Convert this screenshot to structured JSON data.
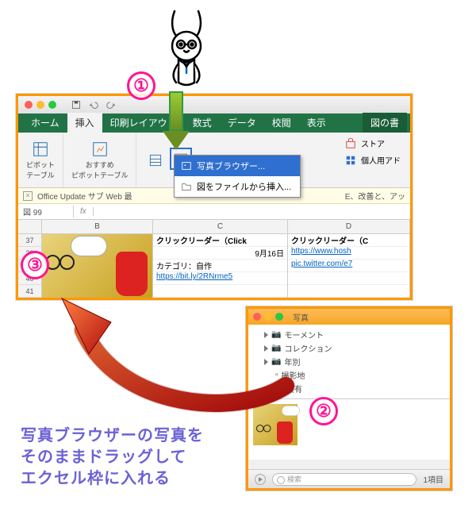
{
  "steps": {
    "one": "①",
    "two": "②",
    "three": "③"
  },
  "excel": {
    "tabs": {
      "home": "ホーム",
      "insert": "挿入",
      "page_layout": "印刷レイアウト",
      "formulas": "数式",
      "data": "データ",
      "review": "校閲",
      "view": "表示",
      "picture_format": "図の書"
    },
    "groups": {
      "pivot": "ピボット\nテーブル",
      "recommended_pivot": "おすすめ\nピボットテーブル"
    },
    "store": "ストア",
    "my_addins": "個人用アド",
    "dropdown": {
      "photo_browser": "写真ブラウザー...",
      "from_file": "図をファイルから挿入..."
    },
    "message_bar": "Office Update サブ Web   最",
    "message_bar_tail": "E、改善と、アッ",
    "name_box": "図 99",
    "fx": "fx",
    "columns": {
      "b": "B",
      "c": "C",
      "d": "D"
    },
    "rows": [
      "37",
      "38",
      "39",
      "40",
      "41"
    ],
    "cells": {
      "c_title": "クリックリーダー（Click",
      "c_date": "9月16日",
      "c_cat_label": "カテゴリ：自作",
      "c_link": "https://bit.ly/2RNrme5",
      "d_title": "クリックリーダー（C",
      "d_link": "https://www.hosh",
      "d_pic": "pic.twitter.com/e7"
    }
  },
  "photos": {
    "title": "写真",
    "tree": {
      "moments": "モーメント",
      "collections": "コレクション",
      "years": "年別",
      "places": "撮影地",
      "shared": "共有"
    },
    "search_placeholder": "検索",
    "count": "1項目"
  },
  "caption": {
    "l1": "写真ブラウザーの写真を",
    "l2": "そのままドラッグして",
    "l3": "エクセル枠に入れる"
  }
}
